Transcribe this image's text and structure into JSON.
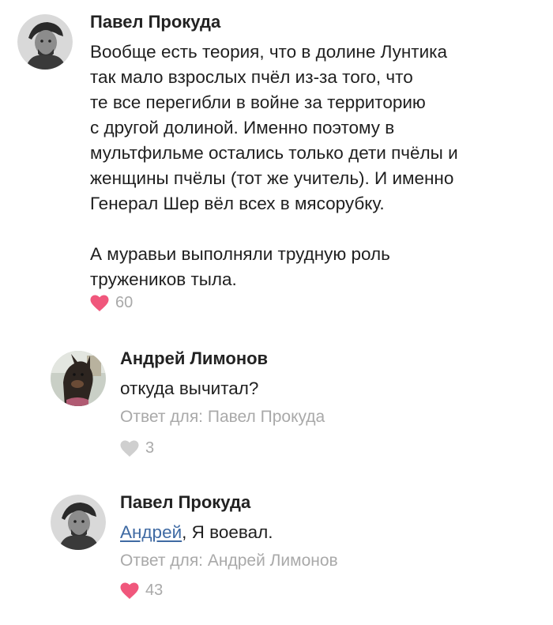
{
  "comments": [
    {
      "author": "Павел Прокуда",
      "lines": [
        "Вообще есть теория, что в долине Лунтика",
        "так мало взрослых пчёл из-за того, что",
        "те все перегибли в войне за территорию",
        "с другой долиной. Именно поэтому в",
        "мультфильме остались только дети пчёлы и",
        "женщины пчёлы (тот же учитель). И именно",
        "Генерал Шер вёл всех в мясорубку."
      ],
      "lines2": [
        "А муравьи выполняли трудную роль",
        "тружеников тыла."
      ],
      "likes": "60",
      "liked": true
    },
    {
      "author": "Андрей Лимонов",
      "text": "откуда вычитал?",
      "reply_to": "Ответ для: Павел Прокуда",
      "likes": "3",
      "liked": false
    },
    {
      "author": "Павел Прокуда",
      "mention": "Андрей",
      "text": ", Я воевал.",
      "reply_to": "Ответ для: Андрей Лимонов",
      "likes": "43",
      "liked": true
    }
  ],
  "colors": {
    "like_active": "#f0577c",
    "like_inactive": "#cfcfcf",
    "meta_text": "#a9a9a9",
    "mention": "#3f6aa3"
  }
}
